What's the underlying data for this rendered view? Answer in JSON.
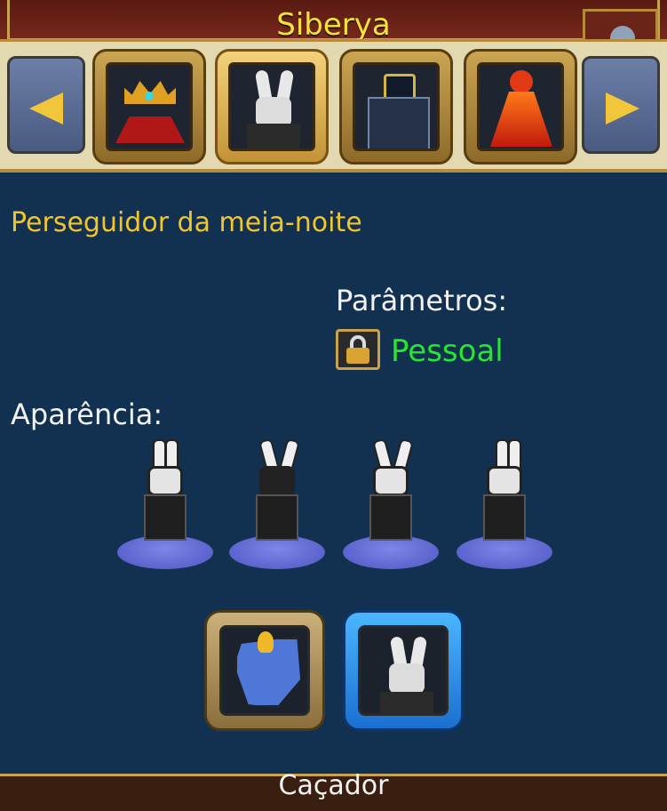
{
  "header": {
    "title": "Siberya"
  },
  "carousel": {
    "prev_icon": "arrow-left-icon",
    "next_icon": "arrow-right-icon",
    "items": [
      {
        "icon": "golden-crown-costume-icon"
      },
      {
        "icon": "white-rabbit-mask-costume-icon",
        "selected": true
      },
      {
        "icon": "dark-armor-costume-icon"
      },
      {
        "icon": "fire-dress-costume-icon"
      }
    ]
  },
  "item": {
    "name": "Perseguidor da meia-noite",
    "params_label": "Parâmetros:",
    "binding": "Pessoal",
    "binding_color": "#25e82c"
  },
  "appearance": {
    "label": "Aparência:",
    "views": [
      "left",
      "back",
      "front",
      "right"
    ]
  },
  "variants": [
    {
      "icon": "blue-mask-icon",
      "frame": "gold"
    },
    {
      "icon": "rabbit-mask-icon",
      "frame": "blue",
      "selected": true
    }
  ],
  "footer": {
    "label": "Caçador"
  },
  "colors": {
    "title": "#f7e23a",
    "item_name": "#f2c52d",
    "background": "#123050"
  }
}
